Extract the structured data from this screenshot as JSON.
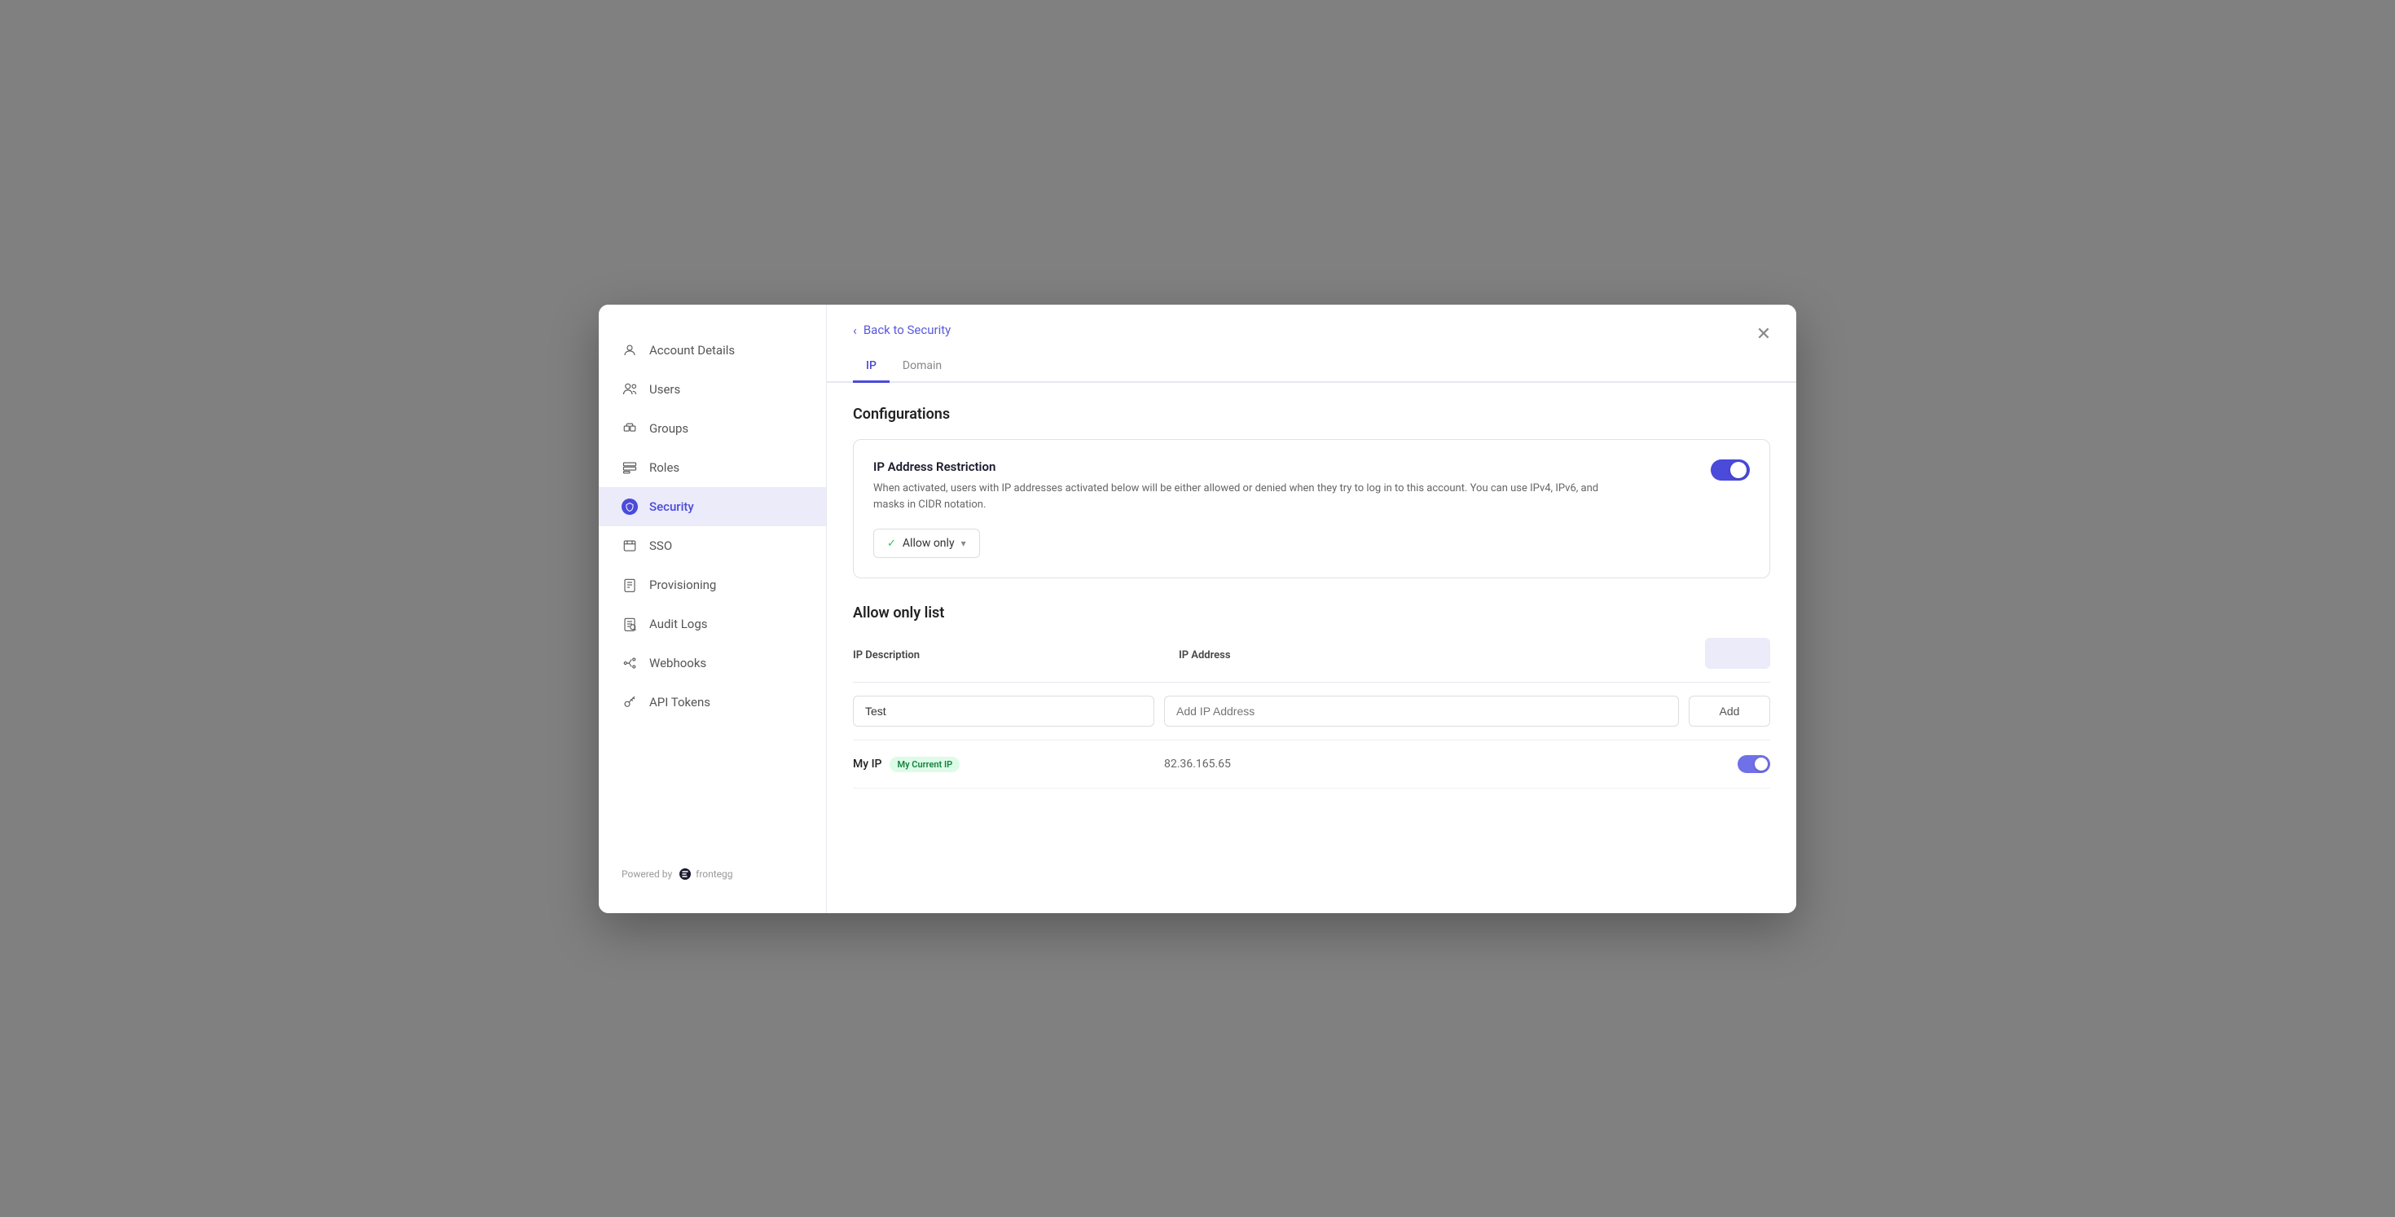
{
  "sidebar": {
    "powered_by": "Powered by",
    "logo_text": "frontegg",
    "items": [
      {
        "id": "account-details",
        "label": "Account Details",
        "icon": "account-icon"
      },
      {
        "id": "users",
        "label": "Users",
        "icon": "users-icon"
      },
      {
        "id": "groups",
        "label": "Groups",
        "icon": "groups-icon"
      },
      {
        "id": "roles",
        "label": "Roles",
        "icon": "roles-icon"
      },
      {
        "id": "security",
        "label": "Security",
        "icon": "security-icon",
        "active": true
      },
      {
        "id": "sso",
        "label": "SSO",
        "icon": "sso-icon"
      },
      {
        "id": "provisioning",
        "label": "Provisioning",
        "icon": "provisioning-icon"
      },
      {
        "id": "audit-logs",
        "label": "Audit Logs",
        "icon": "audit-icon"
      },
      {
        "id": "webhooks",
        "label": "Webhooks",
        "icon": "webhooks-icon"
      },
      {
        "id": "api-tokens",
        "label": "API Tokens",
        "icon": "api-tokens-icon"
      }
    ]
  },
  "header": {
    "back_label": "Back to Security",
    "close_icon": "close-icon"
  },
  "tabs": [
    {
      "id": "ip",
      "label": "IP",
      "active": true
    },
    {
      "id": "domain",
      "label": "Domain",
      "active": false
    }
  ],
  "configurations": {
    "section_title": "Configurations",
    "ip_restriction": {
      "title": "IP Address Restriction",
      "description": "When activated, users with IP addresses activated below will be either allowed or denied when they try to log in to this account. You can use IPv4, IPv6, and masks in CIDR notation.",
      "toggle_on": true,
      "mode_label": "Allow only",
      "mode_check": "✓",
      "mode_chevron": "▾"
    }
  },
  "allow_only_list": {
    "section_title": "Allow only list",
    "columns": {
      "description": "IP Description",
      "ip_address": "IP Address"
    },
    "add_row": {
      "desc_placeholder": "Test",
      "ip_placeholder": "Add IP Address",
      "add_button": "Add"
    },
    "rows": [
      {
        "id": "my-ip",
        "description": "My IP",
        "badge": "My Current IP",
        "ip_address": "82.36.165.65",
        "enabled": true
      }
    ]
  }
}
